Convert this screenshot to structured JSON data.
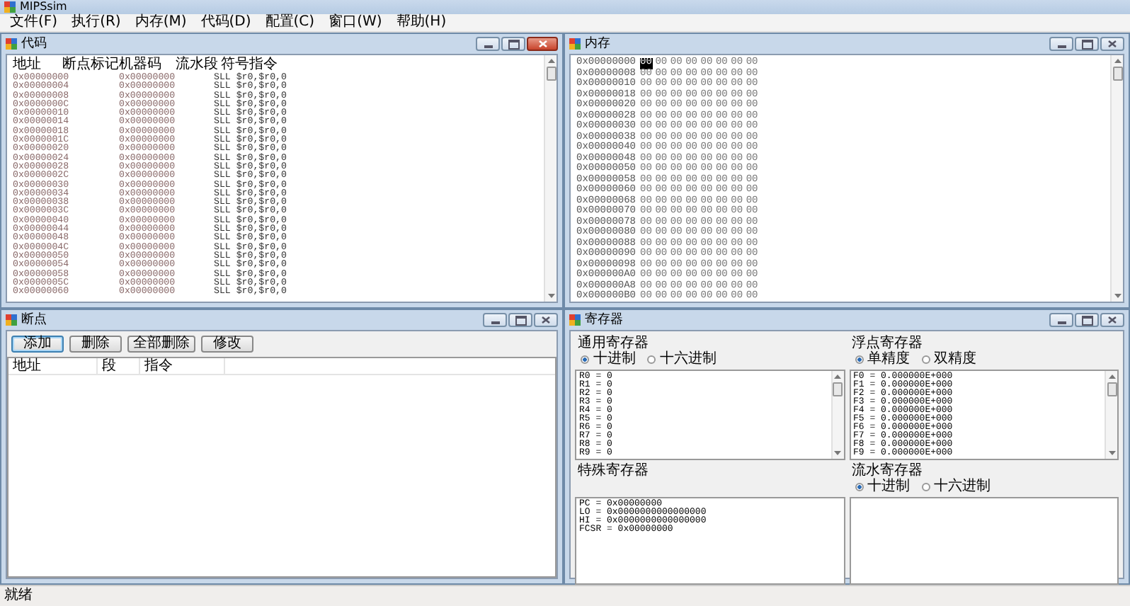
{
  "app": {
    "title": "MIPSsim"
  },
  "menu": [
    "文件(F)",
    "执行(R)",
    "内存(M)",
    "代码(D)",
    "配置(C)",
    "窗口(W)",
    "帮助(H)"
  ],
  "code_window": {
    "title": "代码",
    "active": true,
    "columns": [
      "地址",
      "断点标记",
      "机器码",
      "流水段",
      "符号指令"
    ],
    "rows": [
      {
        "address": "0x00000000",
        "machine_code": "0x00000000",
        "instruction": "SLL $r0,$r0,0"
      },
      {
        "address": "0x00000004",
        "machine_code": "0x00000000",
        "instruction": "SLL $r0,$r0,0"
      },
      {
        "address": "0x00000008",
        "machine_code": "0x00000000",
        "instruction": "SLL $r0,$r0,0"
      },
      {
        "address": "0x0000000C",
        "machine_code": "0x00000000",
        "instruction": "SLL $r0,$r0,0"
      },
      {
        "address": "0x00000010",
        "machine_code": "0x00000000",
        "instruction": "SLL $r0,$r0,0"
      },
      {
        "address": "0x00000014",
        "machine_code": "0x00000000",
        "instruction": "SLL $r0,$r0,0"
      },
      {
        "address": "0x00000018",
        "machine_code": "0x00000000",
        "instruction": "SLL $r0,$r0,0"
      },
      {
        "address": "0x0000001C",
        "machine_code": "0x00000000",
        "instruction": "SLL $r0,$r0,0"
      },
      {
        "address": "0x00000020",
        "machine_code": "0x00000000",
        "instruction": "SLL $r0,$r0,0"
      },
      {
        "address": "0x00000024",
        "machine_code": "0x00000000",
        "instruction": "SLL $r0,$r0,0"
      },
      {
        "address": "0x00000028",
        "machine_code": "0x00000000",
        "instruction": "SLL $r0,$r0,0"
      },
      {
        "address": "0x0000002C",
        "machine_code": "0x00000000",
        "instruction": "SLL $r0,$r0,0"
      },
      {
        "address": "0x00000030",
        "machine_code": "0x00000000",
        "instruction": "SLL $r0,$r0,0"
      },
      {
        "address": "0x00000034",
        "machine_code": "0x00000000",
        "instruction": "SLL $r0,$r0,0"
      },
      {
        "address": "0x00000038",
        "machine_code": "0x00000000",
        "instruction": "SLL $r0,$r0,0"
      },
      {
        "address": "0x0000003C",
        "machine_code": "0x00000000",
        "instruction": "SLL $r0,$r0,0"
      },
      {
        "address": "0x00000040",
        "machine_code": "0x00000000",
        "instruction": "SLL $r0,$r0,0"
      },
      {
        "address": "0x00000044",
        "machine_code": "0x00000000",
        "instruction": "SLL $r0,$r0,0"
      },
      {
        "address": "0x00000048",
        "machine_code": "0x00000000",
        "instruction": "SLL $r0,$r0,0"
      },
      {
        "address": "0x0000004C",
        "machine_code": "0x00000000",
        "instruction": "SLL $r0,$r0,0"
      },
      {
        "address": "0x00000050",
        "machine_code": "0x00000000",
        "instruction": "SLL $r0,$r0,0"
      },
      {
        "address": "0x00000054",
        "machine_code": "0x00000000",
        "instruction": "SLL $r0,$r0,0"
      },
      {
        "address": "0x00000058",
        "machine_code": "0x00000000",
        "instruction": "SLL $r0,$r0,0"
      },
      {
        "address": "0x0000005C",
        "machine_code": "0x00000000",
        "instruction": "SLL $r0,$r0,0"
      },
      {
        "address": "0x00000060",
        "machine_code": "0x00000000",
        "instruction": "SLL $r0,$r0,0"
      }
    ]
  },
  "memory_window": {
    "title": "内存",
    "active": false,
    "rows": [
      {
        "address": "0x00000000",
        "bytes": [
          {
            "value": "00",
            "selected": true
          },
          {
            "value": "00",
            "selected": false
          },
          {
            "value": "00",
            "selected": false
          },
          {
            "value": "00",
            "selected": false
          },
          {
            "value": "00",
            "selected": false
          },
          {
            "value": "00",
            "selected": false
          },
          {
            "value": "00",
            "selected": false
          },
          {
            "value": "00",
            "selected": false
          }
        ]
      },
      {
        "address": "0x00000008",
        "bytes": [
          {
            "value": "00",
            "selected": false
          },
          {
            "value": "00",
            "selected": false
          },
          {
            "value": "00",
            "selected": false
          },
          {
            "value": "00",
            "selected": false
          },
          {
            "value": "00",
            "selected": false
          },
          {
            "value": "00",
            "selected": false
          },
          {
            "value": "00",
            "selected": false
          },
          {
            "value": "00",
            "selected": false
          }
        ]
      },
      {
        "address": "0x00000010",
        "bytes": [
          {
            "value": "00",
            "selected": false
          },
          {
            "value": "00",
            "selected": false
          },
          {
            "value": "00",
            "selected": false
          },
          {
            "value": "00",
            "selected": false
          },
          {
            "value": "00",
            "selected": false
          },
          {
            "value": "00",
            "selected": false
          },
          {
            "value": "00",
            "selected": false
          },
          {
            "value": "00",
            "selected": false
          }
        ]
      },
      {
        "address": "0x00000018",
        "bytes": [
          {
            "value": "00",
            "selected": false
          },
          {
            "value": "00",
            "selected": false
          },
          {
            "value": "00",
            "selected": false
          },
          {
            "value": "00",
            "selected": false
          },
          {
            "value": "00",
            "selected": false
          },
          {
            "value": "00",
            "selected": false
          },
          {
            "value": "00",
            "selected": false
          },
          {
            "value": "00",
            "selected": false
          }
        ]
      },
      {
        "address": "0x00000020",
        "bytes": [
          {
            "value": "00",
            "selected": false
          },
          {
            "value": "00",
            "selected": false
          },
          {
            "value": "00",
            "selected": false
          },
          {
            "value": "00",
            "selected": false
          },
          {
            "value": "00",
            "selected": false
          },
          {
            "value": "00",
            "selected": false
          },
          {
            "value": "00",
            "selected": false
          },
          {
            "value": "00",
            "selected": false
          }
        ]
      },
      {
        "address": "0x00000028",
        "bytes": [
          {
            "value": "00",
            "selected": false
          },
          {
            "value": "00",
            "selected": false
          },
          {
            "value": "00",
            "selected": false
          },
          {
            "value": "00",
            "selected": false
          },
          {
            "value": "00",
            "selected": false
          },
          {
            "value": "00",
            "selected": false
          },
          {
            "value": "00",
            "selected": false
          },
          {
            "value": "00",
            "selected": false
          }
        ]
      },
      {
        "address": "0x00000030",
        "bytes": [
          {
            "value": "00",
            "selected": false
          },
          {
            "value": "00",
            "selected": false
          },
          {
            "value": "00",
            "selected": false
          },
          {
            "value": "00",
            "selected": false
          },
          {
            "value": "00",
            "selected": false
          },
          {
            "value": "00",
            "selected": false
          },
          {
            "value": "00",
            "selected": false
          },
          {
            "value": "00",
            "selected": false
          }
        ]
      },
      {
        "address": "0x00000038",
        "bytes": [
          {
            "value": "00",
            "selected": false
          },
          {
            "value": "00",
            "selected": false
          },
          {
            "value": "00",
            "selected": false
          },
          {
            "value": "00",
            "selected": false
          },
          {
            "value": "00",
            "selected": false
          },
          {
            "value": "00",
            "selected": false
          },
          {
            "value": "00",
            "selected": false
          },
          {
            "value": "00",
            "selected": false
          }
        ]
      },
      {
        "address": "0x00000040",
        "bytes": [
          {
            "value": "00",
            "selected": false
          },
          {
            "value": "00",
            "selected": false
          },
          {
            "value": "00",
            "selected": false
          },
          {
            "value": "00",
            "selected": false
          },
          {
            "value": "00",
            "selected": false
          },
          {
            "value": "00",
            "selected": false
          },
          {
            "value": "00",
            "selected": false
          },
          {
            "value": "00",
            "selected": false
          }
        ]
      },
      {
        "address": "0x00000048",
        "bytes": [
          {
            "value": "00",
            "selected": false
          },
          {
            "value": "00",
            "selected": false
          },
          {
            "value": "00",
            "selected": false
          },
          {
            "value": "00",
            "selected": false
          },
          {
            "value": "00",
            "selected": false
          },
          {
            "value": "00",
            "selected": false
          },
          {
            "value": "00",
            "selected": false
          },
          {
            "value": "00",
            "selected": false
          }
        ]
      },
      {
        "address": "0x00000050",
        "bytes": [
          {
            "value": "00",
            "selected": false
          },
          {
            "value": "00",
            "selected": false
          },
          {
            "value": "00",
            "selected": false
          },
          {
            "value": "00",
            "selected": false
          },
          {
            "value": "00",
            "selected": false
          },
          {
            "value": "00",
            "selected": false
          },
          {
            "value": "00",
            "selected": false
          },
          {
            "value": "00",
            "selected": false
          }
        ]
      },
      {
        "address": "0x00000058",
        "bytes": [
          {
            "value": "00",
            "selected": false
          },
          {
            "value": "00",
            "selected": false
          },
          {
            "value": "00",
            "selected": false
          },
          {
            "value": "00",
            "selected": false
          },
          {
            "value": "00",
            "selected": false
          },
          {
            "value": "00",
            "selected": false
          },
          {
            "value": "00",
            "selected": false
          },
          {
            "value": "00",
            "selected": false
          }
        ]
      },
      {
        "address": "0x00000060",
        "bytes": [
          {
            "value": "00",
            "selected": false
          },
          {
            "value": "00",
            "selected": false
          },
          {
            "value": "00",
            "selected": false
          },
          {
            "value": "00",
            "selected": false
          },
          {
            "value": "00",
            "selected": false
          },
          {
            "value": "00",
            "selected": false
          },
          {
            "value": "00",
            "selected": false
          },
          {
            "value": "00",
            "selected": false
          }
        ]
      },
      {
        "address": "0x00000068",
        "bytes": [
          {
            "value": "00",
            "selected": false
          },
          {
            "value": "00",
            "selected": false
          },
          {
            "value": "00",
            "selected": false
          },
          {
            "value": "00",
            "selected": false
          },
          {
            "value": "00",
            "selected": false
          },
          {
            "value": "00",
            "selected": false
          },
          {
            "value": "00",
            "selected": false
          },
          {
            "value": "00",
            "selected": false
          }
        ]
      },
      {
        "address": "0x00000070",
        "bytes": [
          {
            "value": "00",
            "selected": false
          },
          {
            "value": "00",
            "selected": false
          },
          {
            "value": "00",
            "selected": false
          },
          {
            "value": "00",
            "selected": false
          },
          {
            "value": "00",
            "selected": false
          },
          {
            "value": "00",
            "selected": false
          },
          {
            "value": "00",
            "selected": false
          },
          {
            "value": "00",
            "selected": false
          }
        ]
      },
      {
        "address": "0x00000078",
        "bytes": [
          {
            "value": "00",
            "selected": false
          },
          {
            "value": "00",
            "selected": false
          },
          {
            "value": "00",
            "selected": false
          },
          {
            "value": "00",
            "selected": false
          },
          {
            "value": "00",
            "selected": false
          },
          {
            "value": "00",
            "selected": false
          },
          {
            "value": "00",
            "selected": false
          },
          {
            "value": "00",
            "selected": false
          }
        ]
      },
      {
        "address": "0x00000080",
        "bytes": [
          {
            "value": "00",
            "selected": false
          },
          {
            "value": "00",
            "selected": false
          },
          {
            "value": "00",
            "selected": false
          },
          {
            "value": "00",
            "selected": false
          },
          {
            "value": "00",
            "selected": false
          },
          {
            "value": "00",
            "selected": false
          },
          {
            "value": "00",
            "selected": false
          },
          {
            "value": "00",
            "selected": false
          }
        ]
      },
      {
        "address": "0x00000088",
        "bytes": [
          {
            "value": "00",
            "selected": false
          },
          {
            "value": "00",
            "selected": false
          },
          {
            "value": "00",
            "selected": false
          },
          {
            "value": "00",
            "selected": false
          },
          {
            "value": "00",
            "selected": false
          },
          {
            "value": "00",
            "selected": false
          },
          {
            "value": "00",
            "selected": false
          },
          {
            "value": "00",
            "selected": false
          }
        ]
      },
      {
        "address": "0x00000090",
        "bytes": [
          {
            "value": "00",
            "selected": false
          },
          {
            "value": "00",
            "selected": false
          },
          {
            "value": "00",
            "selected": false
          },
          {
            "value": "00",
            "selected": false
          },
          {
            "value": "00",
            "selected": false
          },
          {
            "value": "00",
            "selected": false
          },
          {
            "value": "00",
            "selected": false
          },
          {
            "value": "00",
            "selected": false
          }
        ]
      },
      {
        "address": "0x00000098",
        "bytes": [
          {
            "value": "00",
            "selected": false
          },
          {
            "value": "00",
            "selected": false
          },
          {
            "value": "00",
            "selected": false
          },
          {
            "value": "00",
            "selected": false
          },
          {
            "value": "00",
            "selected": false
          },
          {
            "value": "00",
            "selected": false
          },
          {
            "value": "00",
            "selected": false
          },
          {
            "value": "00",
            "selected": false
          }
        ]
      },
      {
        "address": "0x000000A0",
        "bytes": [
          {
            "value": "00",
            "selected": false
          },
          {
            "value": "00",
            "selected": false
          },
          {
            "value": "00",
            "selected": false
          },
          {
            "value": "00",
            "selected": false
          },
          {
            "value": "00",
            "selected": false
          },
          {
            "value": "00",
            "selected": false
          },
          {
            "value": "00",
            "selected": false
          },
          {
            "value": "00",
            "selected": false
          }
        ]
      },
      {
        "address": "0x000000A8",
        "bytes": [
          {
            "value": "00",
            "selected": false
          },
          {
            "value": "00",
            "selected": false
          },
          {
            "value": "00",
            "selected": false
          },
          {
            "value": "00",
            "selected": false
          },
          {
            "value": "00",
            "selected": false
          },
          {
            "value": "00",
            "selected": false
          },
          {
            "value": "00",
            "selected": false
          },
          {
            "value": "00",
            "selected": false
          }
        ]
      },
      {
        "address": "0x000000B0",
        "bytes": [
          {
            "value": "00",
            "selected": false
          },
          {
            "value": "00",
            "selected": false
          },
          {
            "value": "00",
            "selected": false
          },
          {
            "value": "00",
            "selected": false
          },
          {
            "value": "00",
            "selected": false
          },
          {
            "value": "00",
            "selected": false
          },
          {
            "value": "00",
            "selected": false
          },
          {
            "value": "00",
            "selected": false
          }
        ]
      }
    ]
  },
  "breakpoint_window": {
    "title": "断点",
    "active": false,
    "buttons": [
      {
        "label": "添加",
        "focused": true
      },
      {
        "label": "删除",
        "focused": false
      },
      {
        "label": "全部删除",
        "focused": false
      },
      {
        "label": "修改",
        "focused": false
      }
    ],
    "columns": [
      "地址",
      "段",
      "指令"
    ]
  },
  "register_window": {
    "title": "寄存器",
    "active": false,
    "general": {
      "label": "通用寄存器",
      "options": [
        {
          "label": "十进制",
          "selected": true
        },
        {
          "label": "十六进制",
          "selected": false
        }
      ],
      "lines": [
        "R0 = 0",
        "R1 = 0",
        "R2 = 0",
        "R3 = 0",
        "R4 = 0",
        "R5 = 0",
        "R6 = 0",
        "R7 = 0",
        "R8 = 0",
        "R9 = 0"
      ]
    },
    "float": {
      "label": "浮点寄存器",
      "options": [
        {
          "label": "单精度",
          "selected": true
        },
        {
          "label": "双精度",
          "selected": false
        }
      ],
      "lines": [
        "F0 = 0.000000E+000",
        "F1 = 0.000000E+000",
        "F2 = 0.000000E+000",
        "F3 = 0.000000E+000",
        "F4 = 0.000000E+000",
        "F5 = 0.000000E+000",
        "F6 = 0.000000E+000",
        "F7 = 0.000000E+000",
        "F8 = 0.000000E+000",
        "F9 = 0.000000E+000"
      ]
    },
    "special": {
      "label": "特殊寄存器",
      "lines": [
        "PC = 0x00000000",
        "LO = 0x0000000000000000",
        "HI = 0x0000000000000000",
        "FCSR = 0x00000000"
      ]
    },
    "pipeline": {
      "label": "流水寄存器",
      "options": [
        {
          "label": "十进制",
          "selected": true
        },
        {
          "label": "十六进制",
          "selected": false
        }
      ]
    }
  },
  "status_bar": {
    "text": "就绪"
  }
}
